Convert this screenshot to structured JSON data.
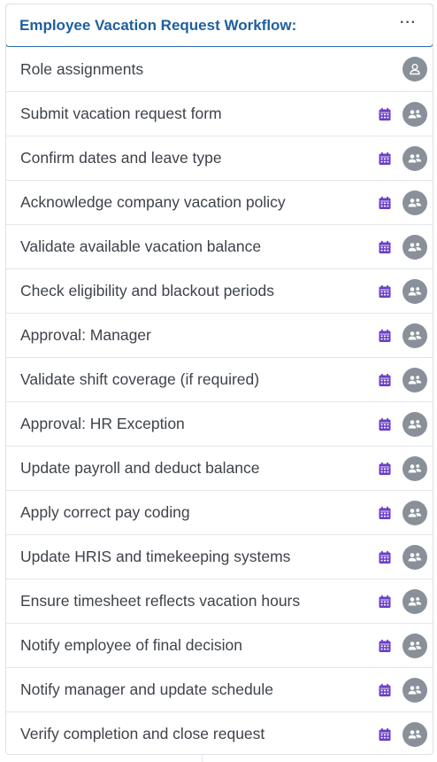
{
  "header": {
    "title": "Employee Vacation Request Workflow:",
    "more_label": "···"
  },
  "role_row": {
    "label": "Role assignments",
    "icon": "user-icon"
  },
  "tasks": [
    {
      "label": "Submit vacation request form"
    },
    {
      "label": "Confirm dates and leave type"
    },
    {
      "label": "Acknowledge company vacation policy"
    },
    {
      "label": "Validate available vacation balance"
    },
    {
      "label": "Check eligibility and blackout periods"
    },
    {
      "label": "Approval: Manager"
    },
    {
      "label": "Validate shift coverage (if required)"
    },
    {
      "label": "Approval: HR Exception"
    },
    {
      "label": "Update payroll and deduct balance"
    },
    {
      "label": "Apply correct pay coding"
    },
    {
      "label": "Update HRIS and timekeeping systems"
    },
    {
      "label": "Ensure timesheet reflects vacation hours"
    },
    {
      "label": "Notify employee of final decision"
    },
    {
      "label": "Notify manager and update schedule"
    },
    {
      "label": "Verify completion and close request"
    }
  ],
  "icons": {
    "task_schedule": "calendar-icon",
    "task_assignee": "users-icon"
  },
  "colors": {
    "title": "#1f5f9e",
    "header_border": "#2a6ca8",
    "calendar": "#6a3fc6",
    "avatar_bg": "#8a9099",
    "text": "#3e434a"
  }
}
